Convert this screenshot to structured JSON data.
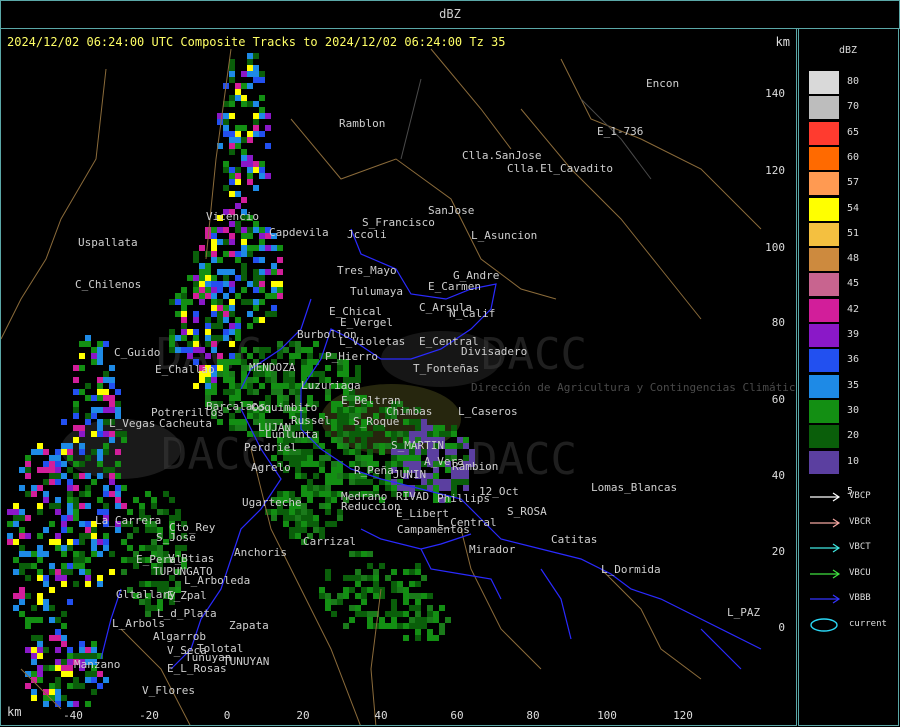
{
  "window": {
    "title": "dBZ"
  },
  "header": {
    "title": "2024/12/02 06:24:00 UTC Composite Tracks to 2024/12/02 06:24:00 Tz 35",
    "km_top": "km",
    "km_bottom": "km"
  },
  "axes": {
    "x_ticks": [
      "-40",
      "-20",
      "0",
      "20",
      "40",
      "60",
      "80",
      "100",
      "120"
    ],
    "y_ticks": [
      "140",
      "120",
      "100",
      "80",
      "60",
      "40",
      "20",
      "0"
    ]
  },
  "watermarks": [
    "DACC",
    "DACC",
    "DACC",
    "DACC",
    "Dirección de Agricultura y Contingencias Climáticas"
  ],
  "cities": [
    "Encon",
    "Ramblon",
    "E_1-736",
    "Clla.SanJose",
    "Clla.El_Cavadito",
    "Vicencio",
    "S_Francisco",
    "SanJose",
    "Uspallata",
    "Capdevila",
    "Jccoli",
    "L_Asuncion",
    "Tres_Mayo",
    "G_Andre",
    "Tulumaya",
    "E_Carmen",
    "C_Chilenos",
    "E_Chical",
    "C_Arsula",
    "E_Vergel",
    "N_Calif",
    "Burbollon",
    "E_Central",
    "Divisadero",
    "C_Guido",
    "P_Hierro",
    "L_Violetas",
    "E_Challao",
    "MENDOZA",
    "T_Fonteñas",
    "Luzuriaga",
    "E_Beltran",
    "Barcalaos",
    "Potrerillos",
    "Chimbas",
    "L_Vegas",
    "Cacheuta",
    "Coquimbito",
    "S_Roque",
    "L_Caseros",
    "LUJAN",
    "Lunlunta",
    "Russel",
    "Perdriel",
    "S_MARTIN",
    "Agrelo",
    "A_Vera",
    "Rambion",
    "R_Peña",
    "JUNIN",
    "12_Oct",
    "Phillips",
    "Lomas_Blancas",
    "Medrano",
    "RIVAD",
    "Ugarteche",
    "Reduccion",
    "E_Libert",
    "S_ROSA",
    "La_Carrera",
    "Cto_Rey",
    "Campamentos",
    "L_Central",
    "S_Jose",
    "Carrizal",
    "Catitas",
    "Anchoris",
    "Mirador",
    "E_Peral",
    "V_Btias",
    "TUPUNGATO",
    "L_Arboleda",
    "L_Dormida",
    "Gltallary",
    "E_Zpal",
    "L_d_Plata",
    "Zapata",
    "L_PAZ",
    "L_Arbols",
    "Algarrob",
    "V_Seca",
    "Tolotal",
    "Tunuyan",
    "Manzano",
    "E_L_Rosas",
    "TUNUYAN",
    "V_Flores"
  ],
  "legend": {
    "title": "dBZ",
    "colors": [
      "#d9d9d9",
      "#bdbdbd",
      "#ff3b2f",
      "#ff6a00",
      "#ff9a52",
      "#ffff00",
      "#f4c040",
      "#cd8a3e",
      "#c8648f",
      "#d21e9a",
      "#8a18c8",
      "#2250f0",
      "#1e8ae6",
      "#138f13",
      "#0a5e0a",
      "#5b3fa0"
    ],
    "levels": [
      "80",
      "70",
      "65",
      "60",
      "57",
      "54",
      "51",
      "48",
      "45",
      "42",
      "39",
      "36",
      "35",
      "30",
      "20",
      "10",
      "5"
    ],
    "tracks": [
      {
        "label": "VBCP",
        "color": "#ffffff"
      },
      {
        "label": "VBCR",
        "color": "#f2a6a0"
      },
      {
        "label": "VBCT",
        "color": "#3fe6e0"
      },
      {
        "label": "VBCU",
        "color": "#3fe03f"
      },
      {
        "label": "VBBB",
        "color": "#3333ff"
      }
    ],
    "current": {
      "label": "current",
      "color": "#2ad7f5"
    }
  }
}
